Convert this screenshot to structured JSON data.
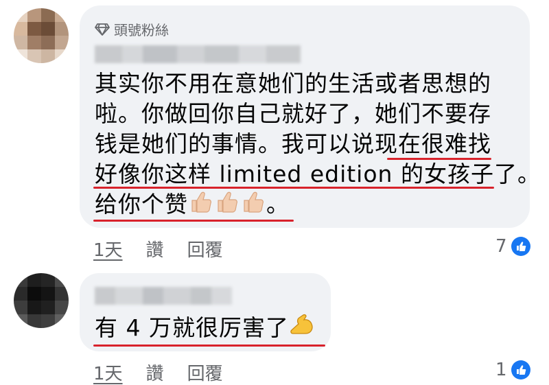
{
  "comments": [
    {
      "badge_label": "頭號粉絲",
      "badge_icon": "diamond-icon",
      "text_lines": [
        "其实你不用在意她们的生活或者思想的",
        "啦。你做回你自己就好了，她们不要存",
        "钱是她们的事情。我可以说现在很难找",
        "好像你这样 limited edition 的女孩子了。",
        "给你个赞"
      ],
      "text_end": "。",
      "emoji": "thumbs-up-icon ×3",
      "time": "1天",
      "like_label": "讚",
      "reply_label": "回覆",
      "reaction_count": "7"
    },
    {
      "text": "有 4 万就很厉害了",
      "emoji": "flexed-biceps-icon",
      "time": "1天",
      "like_label": "讚",
      "reply_label": "回覆",
      "reaction_count": "1"
    }
  ],
  "colors": {
    "bubble": "#f0f2f5",
    "underline": "#d8222b",
    "like": "#1877f2",
    "meta": "#65676b"
  }
}
